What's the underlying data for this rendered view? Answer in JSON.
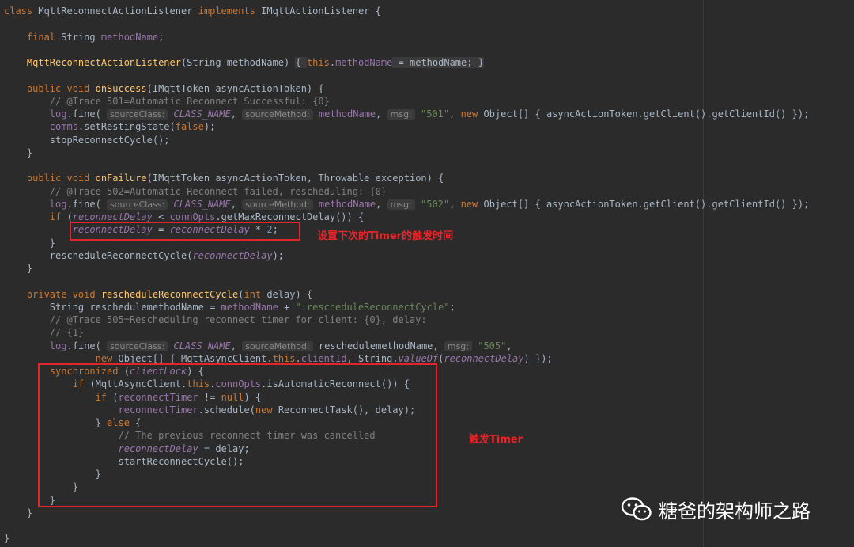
{
  "code": [
    [
      [
        "kw",
        "class "
      ],
      [
        "",
        "MqttReconnectActionListener "
      ],
      [
        "kw",
        "implements "
      ],
      [
        "",
        "IMqttActionListener {"
      ]
    ],
    [],
    [
      [
        "",
        "    "
      ],
      [
        "kw",
        "final "
      ],
      [
        "",
        "String "
      ],
      [
        "fld",
        "methodName"
      ],
      [
        "",
        ";"
      ]
    ],
    [],
    [
      [
        "",
        "    "
      ],
      [
        "fn",
        "MqttReconnectActionListener"
      ],
      [
        "",
        "(String methodName) "
      ],
      [
        "fold",
        "{ "
      ],
      [
        "kw",
        "this"
      ],
      [
        "",
        "."
      ],
      [
        "fld",
        "methodName"
      ],
      [
        "fold",
        " = methodName; }"
      ]
    ],
    [],
    [
      [
        "",
        "    "
      ],
      [
        "kw",
        "public void "
      ],
      [
        "fn",
        "onSuccess"
      ],
      [
        "",
        "(IMqttToken asyncActionToken) {"
      ]
    ],
    [
      [
        "",
        "        "
      ],
      [
        "cm",
        "// @Trace 501=Automatic Reconnect Successful: {0}"
      ]
    ],
    [
      [
        "",
        "        "
      ],
      [
        "fld",
        "log"
      ],
      [
        "",
        ".fine( "
      ],
      [
        "hint",
        "sourceClass:"
      ],
      [
        "fldi",
        " CLASS_NAME"
      ],
      [
        "",
        ", "
      ],
      [
        "hint",
        "sourceMethod:"
      ],
      [
        "fld",
        " methodName"
      ],
      [
        "",
        ", "
      ],
      [
        "hint",
        "msg:"
      ],
      [
        "str",
        " \"501\""
      ],
      [
        "",
        ", "
      ],
      [
        "kw",
        "new "
      ],
      [
        "",
        "Object[] { asyncActionToken.getClient().getClientId() });"
      ]
    ],
    [
      [
        "",
        "        "
      ],
      [
        "fld",
        "comms"
      ],
      [
        "",
        ".setRestingState("
      ],
      [
        "kw",
        "false"
      ],
      [
        "",
        ");"
      ]
    ],
    [
      [
        "",
        "        "
      ],
      [
        "",
        "stopReconnectCycle();"
      ]
    ],
    [
      [
        "",
        "    }"
      ]
    ],
    [],
    [
      [
        "",
        "    "
      ],
      [
        "kw",
        "public void "
      ],
      [
        "fn",
        "onFailure"
      ],
      [
        "",
        "(IMqttToken asyncActionToken, Throwable exception) {"
      ]
    ],
    [
      [
        "",
        "        "
      ],
      [
        "cm",
        "// @Trace 502=Automatic Reconnect failed, rescheduling: {0}"
      ]
    ],
    [
      [
        "",
        "        "
      ],
      [
        "fld",
        "log"
      ],
      [
        "",
        ".fine( "
      ],
      [
        "hint",
        "sourceClass:"
      ],
      [
        "fldi",
        " CLASS_NAME"
      ],
      [
        "",
        ", "
      ],
      [
        "hint",
        "sourceMethod:"
      ],
      [
        "fld",
        " methodName"
      ],
      [
        "",
        ", "
      ],
      [
        "hint",
        "msg:"
      ],
      [
        "str",
        " \"502\""
      ],
      [
        "",
        ", "
      ],
      [
        "kw",
        "new "
      ],
      [
        "",
        "Object[] { asyncActionToken.getClient().getClientId() });"
      ]
    ],
    [
      [
        "",
        "        "
      ],
      [
        "kw",
        "if "
      ],
      [
        "",
        "("
      ],
      [
        "fldi",
        "reconnectDelay"
      ],
      [
        "",
        " < "
      ],
      [
        "fld",
        "connOpts"
      ],
      [
        "",
        ".getMaxReconnectDelay()) {"
      ]
    ],
    [
      [
        "",
        "            "
      ],
      [
        "fldi",
        "reconnectDelay"
      ],
      [
        "",
        " = "
      ],
      [
        "fldi",
        "reconnectDelay"
      ],
      [
        "",
        " * "
      ],
      [
        "num",
        "2"
      ],
      [
        "",
        ";"
      ]
    ],
    [
      [
        "",
        "        }"
      ]
    ],
    [
      [
        "",
        "        "
      ],
      [
        "",
        "rescheduleReconnectCycle("
      ],
      [
        "fldi",
        "reconnectDelay"
      ],
      [
        "",
        ");"
      ]
    ],
    [
      [
        "",
        "    }"
      ]
    ],
    [],
    [
      [
        "",
        "    "
      ],
      [
        "kw",
        "private void "
      ],
      [
        "fn",
        "rescheduleReconnectCycle"
      ],
      [
        "",
        "("
      ],
      [
        "kw",
        "int "
      ],
      [
        "",
        "delay) {"
      ]
    ],
    [
      [
        "",
        "        "
      ],
      [
        "",
        "String reschedulemethodName = "
      ],
      [
        "fld",
        "methodName"
      ],
      [
        "",
        " + "
      ],
      [
        "str",
        "\":rescheduleReconnectCycle\""
      ],
      [
        "",
        ";"
      ]
    ],
    [
      [
        "",
        "        "
      ],
      [
        "cm",
        "// @Trace 505=Rescheduling reconnect timer for client: {0}, delay:"
      ]
    ],
    [
      [
        "",
        "        "
      ],
      [
        "cm",
        "// {1}"
      ]
    ],
    [
      [
        "",
        "        "
      ],
      [
        "fld",
        "log"
      ],
      [
        "",
        ".fine( "
      ],
      [
        "hint",
        "sourceClass:"
      ],
      [
        "fldi",
        " CLASS_NAME"
      ],
      [
        "",
        ", "
      ],
      [
        "hint",
        "sourceMethod:"
      ],
      [
        "",
        " reschedulemethodName, "
      ],
      [
        "hint",
        "msg:"
      ],
      [
        "str",
        " \"505\""
      ],
      [
        "",
        ","
      ]
    ],
    [
      [
        "",
        "                "
      ],
      [
        "kw",
        "new "
      ],
      [
        "",
        "Object[] { MqttAsyncClient."
      ],
      [
        "kw",
        "this"
      ],
      [
        "",
        "."
      ],
      [
        "fld",
        "clientId"
      ],
      [
        "",
        ", String."
      ],
      [
        "fldi",
        "valueOf"
      ],
      [
        "",
        "("
      ],
      [
        "fldi",
        "reconnectDelay"
      ],
      [
        "",
        ") });"
      ]
    ],
    [
      [
        "",
        "        "
      ],
      [
        "kw",
        "synchronized "
      ],
      [
        "",
        "("
      ],
      [
        "fldi",
        "clientLock"
      ],
      [
        "",
        ") {"
      ]
    ],
    [
      [
        "",
        "            "
      ],
      [
        "kw",
        "if "
      ],
      [
        "",
        "(MqttAsyncClient."
      ],
      [
        "kw",
        "this"
      ],
      [
        "",
        "."
      ],
      [
        "fld",
        "connOpts"
      ],
      [
        "",
        ".isAutomaticReconnect()) {"
      ]
    ],
    [
      [
        "",
        "                "
      ],
      [
        "kw",
        "if "
      ],
      [
        "",
        "("
      ],
      [
        "fld",
        "reconnectTimer"
      ],
      [
        "",
        " != "
      ],
      [
        "kw",
        "null"
      ],
      [
        "",
        ") {"
      ]
    ],
    [
      [
        "",
        "                    "
      ],
      [
        "fld",
        "reconnectTimer"
      ],
      [
        "",
        ".schedule("
      ],
      [
        "kw",
        "new "
      ],
      [
        "",
        "ReconnectTask(), delay);"
      ]
    ],
    [
      [
        "",
        "                } "
      ],
      [
        "kw",
        "else "
      ],
      [
        "",
        "{"
      ]
    ],
    [
      [
        "",
        "                    "
      ],
      [
        "cm",
        "// The previous reconnect timer was cancelled"
      ]
    ],
    [
      [
        "",
        "                    "
      ],
      [
        "fldi",
        "reconnectDelay"
      ],
      [
        "",
        " = delay;"
      ]
    ],
    [
      [
        "",
        "                    "
      ],
      [
        "",
        "startReconnectCycle();"
      ]
    ],
    [
      [
        "",
        "                }"
      ]
    ],
    [
      [
        "",
        "            }"
      ]
    ],
    [
      [
        "",
        "        }"
      ]
    ],
    [
      [
        "",
        "    }"
      ]
    ],
    [],
    [
      [
        "",
        "}"
      ]
    ]
  ],
  "annotations": {
    "timer_delay_note": "设置下次的Timer的触发时间",
    "trigger_timer_note": "触发Timer"
  },
  "watermark": {
    "text": "糖爸的架构师之路",
    "icon": "wechat-icon"
  }
}
